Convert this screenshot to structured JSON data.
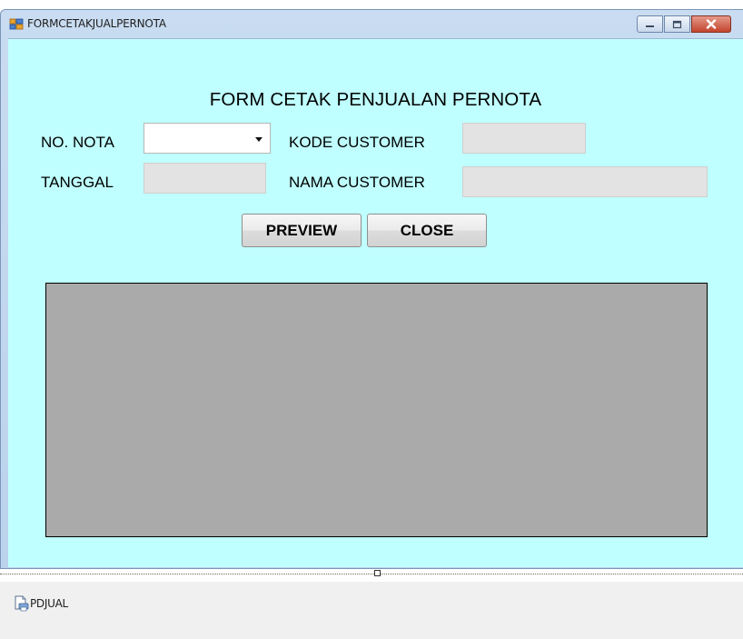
{
  "window": {
    "title": "FORMCETAKJUALPERNOTA",
    "icons": [
      "app-form-icon",
      "minimize-icon",
      "maximize-icon",
      "close-icon"
    ]
  },
  "form": {
    "heading": "FORM CETAK PENJUALAN PERNOTA",
    "no_nota_label": "NO. NOTA",
    "no_nota_value": "",
    "tanggal_label": "TANGGAL",
    "tanggal_value": "",
    "kode_customer_label": "KODE CUSTOMER",
    "kode_customer_value": "",
    "nama_customer_label": "NAMA CUSTOMER",
    "nama_customer_value": "",
    "preview_label": "PREVIEW",
    "close_label": "CLOSE",
    "background_color": "#c0ffff",
    "viewer_color": "#aaaaaa"
  },
  "component_tray": {
    "items": [
      {
        "label": "PDJUAL",
        "icon": "print-document-icon"
      }
    ]
  }
}
